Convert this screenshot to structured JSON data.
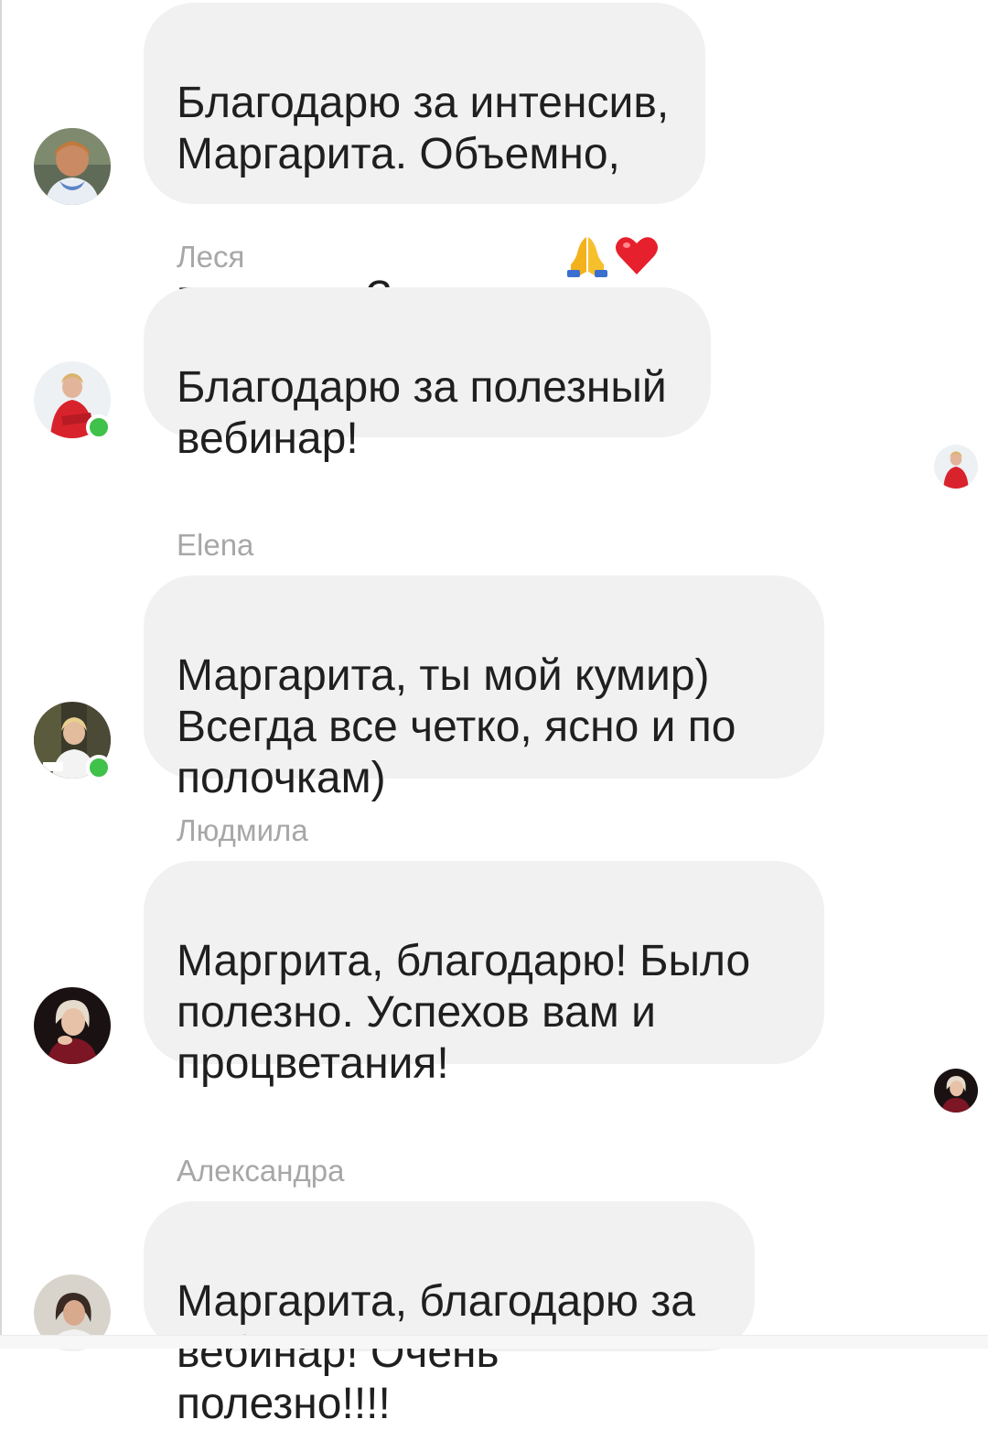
{
  "messages": [
    {
      "sender": "",
      "text": "Благодарю за интенсив,\nМаргарита. Объемно,\nполезно. Здорово.",
      "emojis": [
        "folded-hands-icon",
        "red-heart-icon"
      ]
    },
    {
      "sender": "Леся",
      "text": "Благодарю за полезный\nвебинар!",
      "online": true
    },
    {
      "sender": "Elena",
      "text": "Маргарита, ты мой кумир)\nВсегда все четко, ясно и по\nполочкам)",
      "online": true
    },
    {
      "sender": "Людмила",
      "text": "Маргрита, благодарю! Было\nполезно. Успехов вам и\nпроцветания!"
    },
    {
      "sender": "Александра",
      "text": "Маргарита, благодарю за\nвебинар! Очень полезно!!!!"
    }
  ],
  "colors": {
    "bubble": "#f1f1f1",
    "text": "#1f1f1f",
    "sender": "#a7a7a7",
    "online": "#3fc14a"
  }
}
